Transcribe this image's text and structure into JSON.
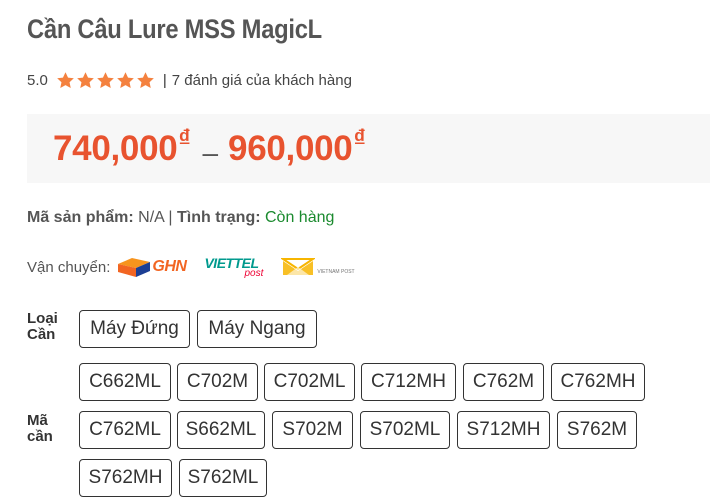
{
  "product": {
    "title": "Cần Câu Lure MSS MagicL",
    "rating": "5.0",
    "stars": 5,
    "rating_separator": "|",
    "review_text": "7 đánh giá của khách hàng",
    "price_from": "740,000",
    "price_to": "960,000",
    "price_dash": "–",
    "currency": "₫",
    "sku_label": "Mã sản phẩm:",
    "sku_value": "N/A",
    "meta_separator": "|",
    "status_label": "Tình trạng:",
    "status_value": "Còn hàng",
    "shipping_label": "Vận chuyển:",
    "carriers": [
      {
        "name": "GHN",
        "text": "GHN"
      },
      {
        "name": "Viettel Post",
        "text_top": "VIETTEL",
        "text_bottom": "post"
      },
      {
        "name": "Vietnam Post",
        "text": "VIETNAM POST"
      }
    ]
  },
  "colors": {
    "price": "#e8532f",
    "star": "#f4813f",
    "stock": "#1a8a2e",
    "ghn": "#f26522",
    "viettel": "#009a8e"
  },
  "variants": {
    "type_label_line1": "Loại",
    "type_label_line2": "Cần",
    "type_options": [
      "Máy Đứng",
      "Máy Ngang"
    ],
    "code_label_line1": "Mã",
    "code_label_line2": "cần",
    "code_options": [
      "C662ML",
      "C702M",
      "C702ML",
      "C712MH",
      "C762M",
      "C762MH",
      "C762ML",
      "S662ML",
      "S702M",
      "S702ML",
      "S712MH",
      "S762M",
      "S762MH",
      "S762ML"
    ]
  }
}
